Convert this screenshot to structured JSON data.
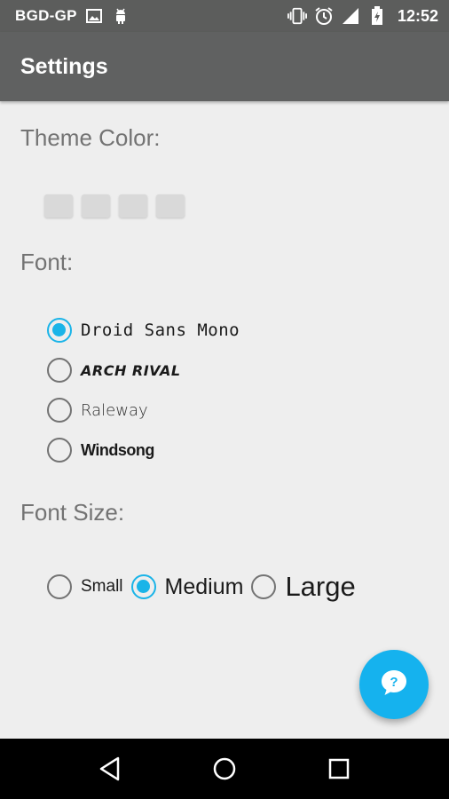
{
  "status_bar": {
    "carrier": "BGD-GP",
    "time": "12:52",
    "icons": [
      "image-icon",
      "android-icon",
      "vibrate-icon",
      "alarm-icon",
      "signal-icon",
      "battery-charging-icon"
    ]
  },
  "app_bar": {
    "title": "Settings"
  },
  "theme_color": {
    "title": "Theme Color:",
    "swatches": [
      "#d9d9d9",
      "#d9d9d9",
      "#d9d9d9",
      "#d9d9d9"
    ]
  },
  "font": {
    "title": "Font:",
    "options": [
      {
        "label": "Droid Sans Mono",
        "checked": true
      },
      {
        "label": "ARCH RIVAL",
        "checked": false
      },
      {
        "label": "Raleway",
        "checked": false
      },
      {
        "label": "Windsong",
        "checked": false
      }
    ]
  },
  "font_size": {
    "title": "Font Size:",
    "options": [
      {
        "label": "Small",
        "checked": false
      },
      {
        "label": "Medium",
        "checked": true
      },
      {
        "label": "Large",
        "checked": false
      }
    ]
  },
  "fab": {
    "icon": "help-chat-icon"
  },
  "nav_bar": {
    "icons": [
      "back-icon",
      "home-icon",
      "recents-icon"
    ]
  },
  "colors": {
    "accent": "#1ab4e8",
    "app_bar": "#606161",
    "status_bar": "#5c5d5c",
    "background": "#eeeeee",
    "section_title": "#737373"
  }
}
